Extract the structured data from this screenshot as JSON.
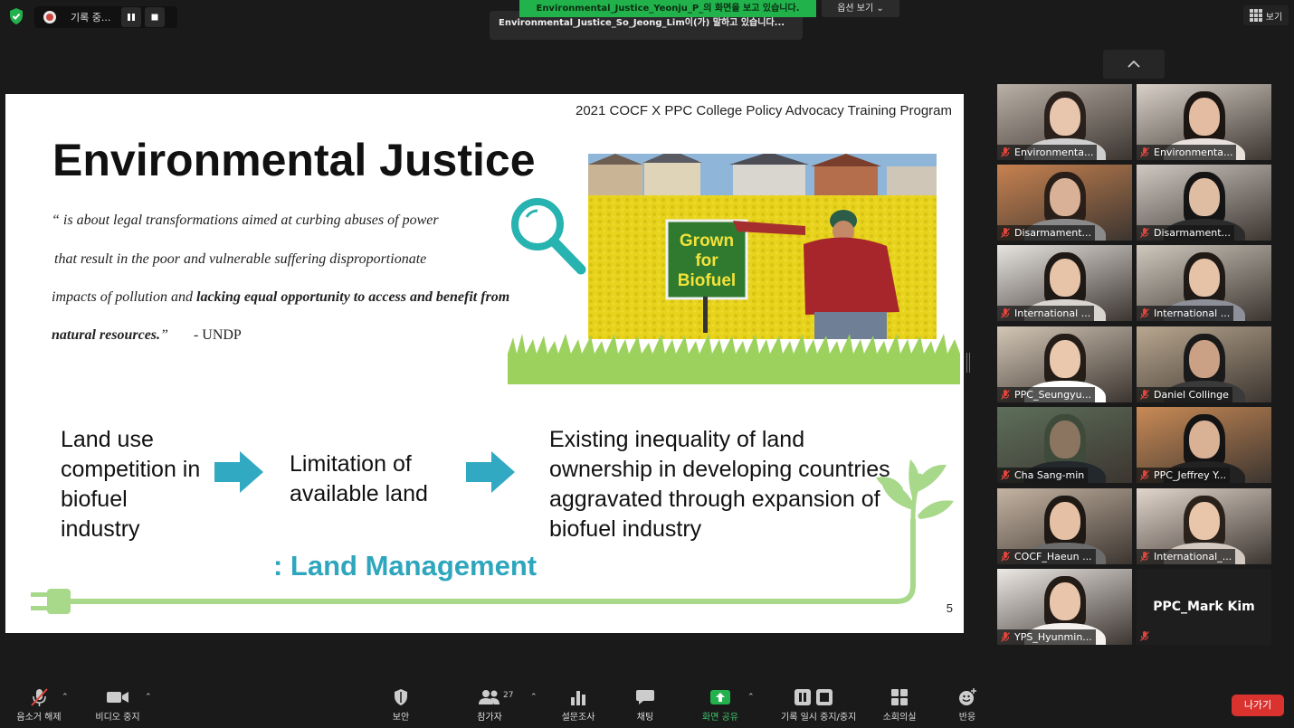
{
  "top_bar": {
    "recording_label": "기록 중...",
    "share_notice": "Environmental_Justice_Yeonju_P_의 화면을 보고 있습니다.",
    "view_options": "옵션 보기",
    "speaking_now": "Environmental_Justice_So_Jeong_Lim이(가) 말하고 있습니다...",
    "view_label": "보기"
  },
  "slide": {
    "program": "2021 COCF X PPC College Policy Advocacy Training Program",
    "title": "Environmental Justice",
    "quote": {
      "line1": "“ is about legal transformations aimed at curbing abuses of power",
      "line2": "that result in the poor and vulnerable suffering disproportionate",
      "line3_plain": "impacts of pollution and ",
      "line3_bold": "lacking equal opportunity to access and benefit from",
      "line4_bold": "natural resources.",
      "line4_close": "”",
      "source": "- UNDP"
    },
    "sign_text": [
      "Grown",
      "for",
      "Biofuel"
    ],
    "flow": {
      "step1": "Land use competition in biofuel industry",
      "step2": "Limitation of available land",
      "step3": "Existing inequality of land ownership in developing countries aggravated through expansion of biofuel industry"
    },
    "conclusion": ": Land Management",
    "page_number": "5"
  },
  "participants": [
    {
      "name": "Environmenta...",
      "skin": "#e8c6ae",
      "hair": "#2a211c",
      "shirt": "#cfcfcf",
      "bg": "#b9b0a6"
    },
    {
      "name": "Environmenta...",
      "skin": "#e3bca2",
      "hair": "#1c1613",
      "shirt": "#e9e2dc",
      "bg": "#d9d1c8"
    },
    {
      "name": "Disarmament...",
      "skin": "#d8b196",
      "hair": "#2a1f18",
      "shirt": "#8a8a8a",
      "bg": "#c78250"
    },
    {
      "name": "Disarmament...",
      "skin": "#dfbda3",
      "hair": "#141414",
      "shirt": "#2b2b2b",
      "bg": "#cfc9c2"
    },
    {
      "name": "International ...",
      "skin": "#e7c3a8",
      "hair": "#1e1915",
      "shirt": "#d8d4cf",
      "bg": "#e7e4e0"
    },
    {
      "name": "International ...",
      "skin": "#e6c2a7",
      "hair": "#201a16",
      "shirt": "#8e9099",
      "bg": "#cfc8bd"
    },
    {
      "name": "PPC_Seungyu...",
      "skin": "#e9c8ae",
      "hair": "#231c17",
      "shirt": "#ffffff",
      "bg": "#d3c6b6"
    },
    {
      "name": "Daniel Collinge",
      "skin": "#caa184",
      "hair": "#1a1a1a",
      "shirt": "#3a3a3a",
      "bg": "#b9a78f"
    },
    {
      "name": "Cha Sang-min",
      "skin": "#8c7560",
      "hair": "#3e4a3a",
      "shirt": "#22282c",
      "bg": "#5d6f5a"
    },
    {
      "name": "PPC_Jeffrey Y...",
      "skin": "#d9b195",
      "hair": "#141414",
      "shirt": "#222222",
      "bg": "#c98a55"
    },
    {
      "name": "COCF_Haeun ...",
      "skin": "#e6c0a4",
      "hair": "#1f1915",
      "shirt": "#6b6b6b",
      "bg": "#c4b3a2"
    },
    {
      "name": "International_...",
      "skin": "#e9c5aa",
      "hair": "#2a211b",
      "shirt": "#d3c9c0",
      "bg": "#e2d6cc"
    },
    {
      "name": "YPS_Hyunmin...",
      "skin": "#e9c6ab",
      "hair": "#221b16",
      "shirt": "#f4f1ee",
      "bg": "#ece8e4"
    },
    {
      "name": "PPC_Mark Kim",
      "no_camera": true
    }
  ],
  "toolbar": {
    "unmute": "음소거 해제",
    "stop_video": "비디오 중지",
    "security": "보안",
    "participants": "참가자",
    "participants_count": "27",
    "polls": "설문조사",
    "chat": "채팅",
    "share_screen": "화면 공유",
    "pause_recording": "기록 일시 중지/중지",
    "breakout_rooms": "소회의실",
    "reactions": "반응",
    "leave": "나가기"
  },
  "colors": {
    "accent_green": "#21b24b",
    "share_green": "#3ec76b",
    "leave_red": "#d9322f",
    "slide_teal": "#2ea6bd",
    "arrow_teal": "#31a9c3",
    "vine_green": "#a8d88a"
  }
}
